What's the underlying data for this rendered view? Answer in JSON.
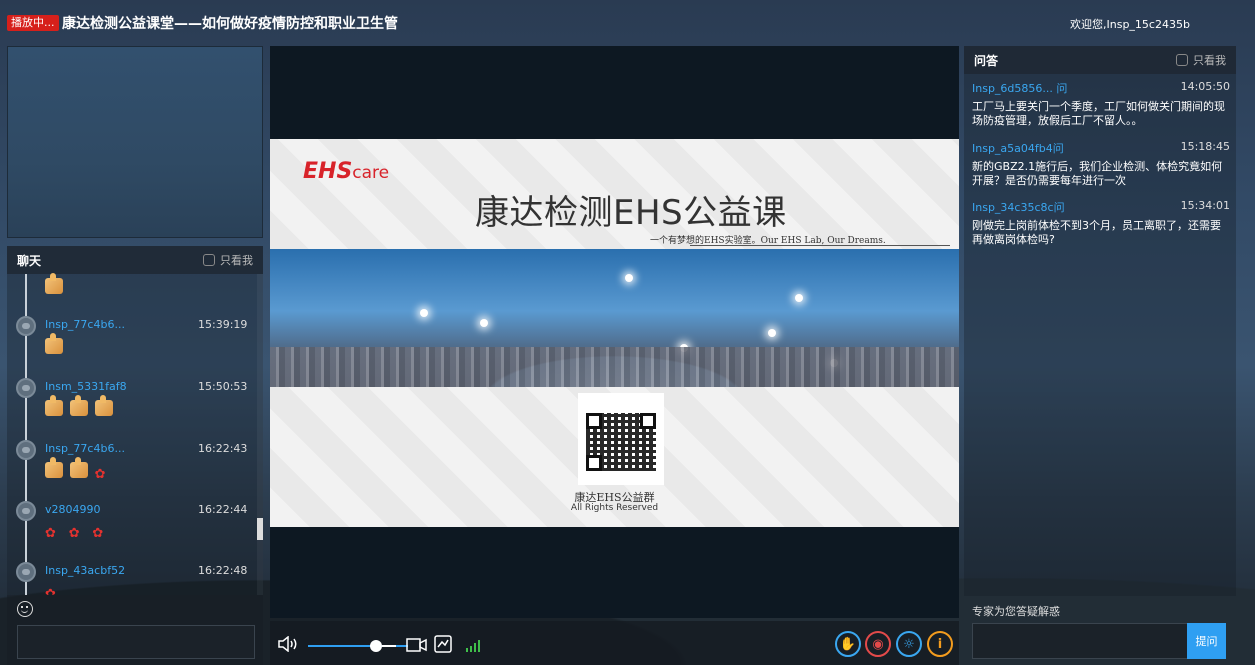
{
  "header": {
    "live_badge": "播放中...",
    "title": "康达检测公益课堂——如何做好疫情防控和职业卫生管",
    "welcome": "欢迎您,Insp_15c2435b"
  },
  "chat": {
    "title": "聊天",
    "only_me_label": "只看我",
    "messages": [
      {
        "user": "",
        "time": "",
        "content": "thumb"
      },
      {
        "user": "Insp_77c4b6...",
        "time": "15:39:19",
        "content": "thumb"
      },
      {
        "user": "Insm_5331faf8",
        "time": "15:50:53",
        "content": "thumb×3"
      },
      {
        "user": "Insp_77c4b6...",
        "time": "16:22:43",
        "content": "thumb×2 rose"
      },
      {
        "user": "v2804990",
        "time": "16:22:44",
        "content": "rose×3"
      },
      {
        "user": "Insp_43acbf52",
        "time": "16:22:48",
        "content": "rose"
      }
    ]
  },
  "slide": {
    "logo_main": "EHS",
    "logo_sub": "care",
    "title": "康达检测EHS公益课",
    "tagline": "一个有梦想的EHS实验室。Our EHS Lab, Our Dreams.",
    "qr_caption": "康达EHS公益群",
    "rights": "All Rights Reserved"
  },
  "qa": {
    "title": "问答",
    "only_me_label": "只看我",
    "items": [
      {
        "user": "Insp_6d5856... 问",
        "time": "14:05:50",
        "text": "工厂马上要关门一个季度，工厂如何做关门期间的现场防疫管理，放假后工厂不留人。。"
      },
      {
        "user": "Insp_a5a04fb4问",
        "time": "15:18:45",
        "text": "新的GBZ2.1施行后，我们企业检测、体检究竟如何开展？是否仍需要每年进行一次"
      },
      {
        "user": "Insp_34c35c8c问",
        "time": "15:34:01",
        "text": "刚做完上岗前体检不到3个月，员工离职了，还需要再做离岗体检吗?"
      }
    ],
    "footer_label": "专家为您答疑解惑",
    "ask_button": "提问"
  },
  "controls": {
    "volume_level": 0.72,
    "colors": {
      "accent": "#2f9ff2",
      "hand": "#3aa7f0",
      "mic": "#e34a4a",
      "light": "#3aa7f0",
      "info": "#f39c1e"
    }
  }
}
